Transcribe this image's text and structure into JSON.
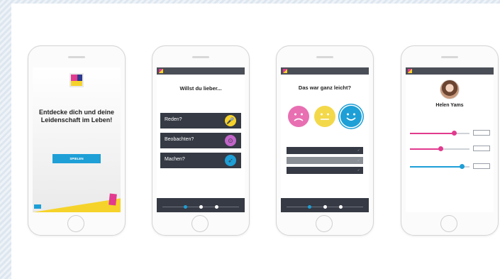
{
  "colors": {
    "accent_blue": "#1e9fd6",
    "accent_pink": "#e23a8e",
    "accent_yellow": "#f6d32a",
    "dark_panel": "#353a44",
    "purple_icon": "#c264c9"
  },
  "phone1": {
    "headline": "Entdecke dich und deine Leidenschaft im Leben!",
    "button_label": "SPIELEN"
  },
  "phone2": {
    "title": "Willst du lieber...",
    "choices": [
      {
        "label": "Reden?",
        "icon": "microphone-icon",
        "color": "#f6d32a"
      },
      {
        "label": "Beobachten?",
        "icon": "binoculars-icon",
        "color": "#c264c9"
      },
      {
        "label": "Machen?",
        "icon": "rocket-icon",
        "color": "#1e9fd6"
      }
    ]
  },
  "phone3": {
    "title": "Das war ganz leicht?",
    "faces": [
      {
        "mood": "sad-face-icon",
        "color": "#e86fb2",
        "glyph": "☹"
      },
      {
        "mood": "neutral-face-icon",
        "color": "#f3d84a",
        "glyph": "😐"
      },
      {
        "mood": "happy-face-icon",
        "color": "#1e9fd6",
        "glyph": "☺",
        "selected": true
      }
    ]
  },
  "phone4": {
    "name": "Helen Yams",
    "sliders": [
      {
        "value": 0.74,
        "color": "#e23a8e"
      },
      {
        "value": 0.52,
        "color": "#e23a8e"
      },
      {
        "value": 0.88,
        "color": "#1e9fd6"
      }
    ]
  }
}
